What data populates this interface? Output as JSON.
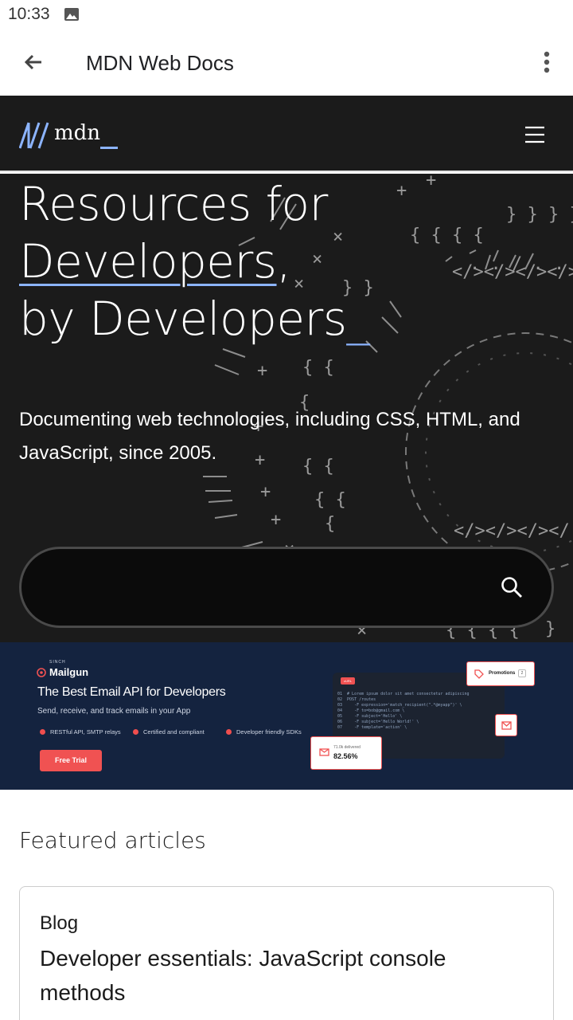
{
  "status_bar": {
    "time": "10:33"
  },
  "app_bar": {
    "title": "MDN Web Docs"
  },
  "header": {
    "logo_text": "mdn"
  },
  "hero": {
    "title_line1": "Resources for",
    "title_line2_word": "Developers",
    "title_line2_punct": ",",
    "title_line3": "by Developers",
    "cursor": "_",
    "subtitle": "Documenting web technologies, including CSS, HTML, and JavaScript, since 2005."
  },
  "search": {
    "placeholder": ""
  },
  "ad": {
    "brand_sup": "SINCH",
    "brand": "Mailgun",
    "headline": "The Best Email API for Developers",
    "sub": "Send, receive, and track emails in your App",
    "features": [
      "RESTful API, SMTP relays",
      "Certified and compliant",
      "Developer friendly SDKs"
    ],
    "cta": "Free Trial",
    "code_tag": "cURL",
    "code": "01  # Lorem ipsum dolor sit amet consectetur adipiscing\n02  POST /routes\n03     -F expression='match_recipient(\".*@myapp\")' \\\n04     -F to=bob@gmail.com \\\n05     -F subject='Hello' \\\n06     -F subject='Hello World!' \\\n07     -F template='action' \\",
    "promo_label": "Promotions",
    "promo_count": "2",
    "delivered_label": "71.0k delivered",
    "delivered_value": "82.56%",
    "accent": "#f05252",
    "background": "#14233f"
  },
  "featured": {
    "heading": "Featured articles",
    "articles": [
      {
        "tag": "Blog",
        "title": "Developer essentials: JavaScript console methods"
      }
    ]
  },
  "colors": {
    "header_bg": "#1b1b1b",
    "accent_blue": "#8cb4ff"
  }
}
